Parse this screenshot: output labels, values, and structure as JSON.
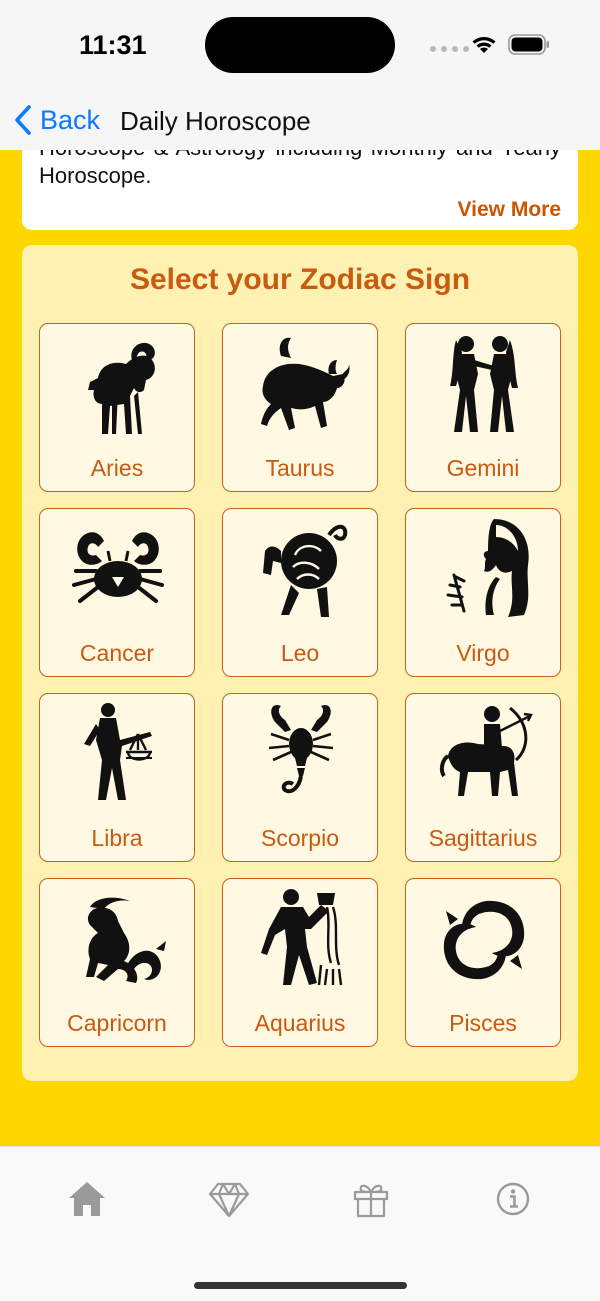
{
  "status_bar": {
    "time": "11:31"
  },
  "nav": {
    "back_label": "Back",
    "title": "Daily Horoscope"
  },
  "intro": {
    "text": "Horoscope & Astrology including Monthly and Yearly Horoscope.",
    "view_more": "View More"
  },
  "zodiac": {
    "title": "Select your Zodiac Sign",
    "signs": [
      {
        "label": "Aries",
        "icon": "aries-ram-icon"
      },
      {
        "label": "Taurus",
        "icon": "taurus-bull-icon"
      },
      {
        "label": "Gemini",
        "icon": "gemini-twins-icon"
      },
      {
        "label": "Cancer",
        "icon": "cancer-crab-icon"
      },
      {
        "label": "Leo",
        "icon": "leo-lion-icon"
      },
      {
        "label": "Virgo",
        "icon": "virgo-maiden-icon"
      },
      {
        "label": "Libra",
        "icon": "libra-scales-icon"
      },
      {
        "label": "Scorpio",
        "icon": "scorpio-scorpion-icon"
      },
      {
        "label": "Sagittarius",
        "icon": "sagittarius-archer-icon"
      },
      {
        "label": "Capricorn",
        "icon": "capricorn-goat-icon"
      },
      {
        "label": "Aquarius",
        "icon": "aquarius-water-bearer-icon"
      },
      {
        "label": "Pisces",
        "icon": "pisces-fish-icon"
      }
    ]
  },
  "tabs": [
    {
      "icon": "home-icon",
      "active": true
    },
    {
      "icon": "diamond-icon",
      "active": false
    },
    {
      "icon": "gift-icon",
      "active": false
    },
    {
      "icon": "info-icon",
      "active": false
    }
  ],
  "colors": {
    "background": "#ffd700",
    "accent_text": "#c95a12",
    "link": "#0a7aff",
    "panel": "#fff1b2",
    "tile": "#fff8e2"
  }
}
